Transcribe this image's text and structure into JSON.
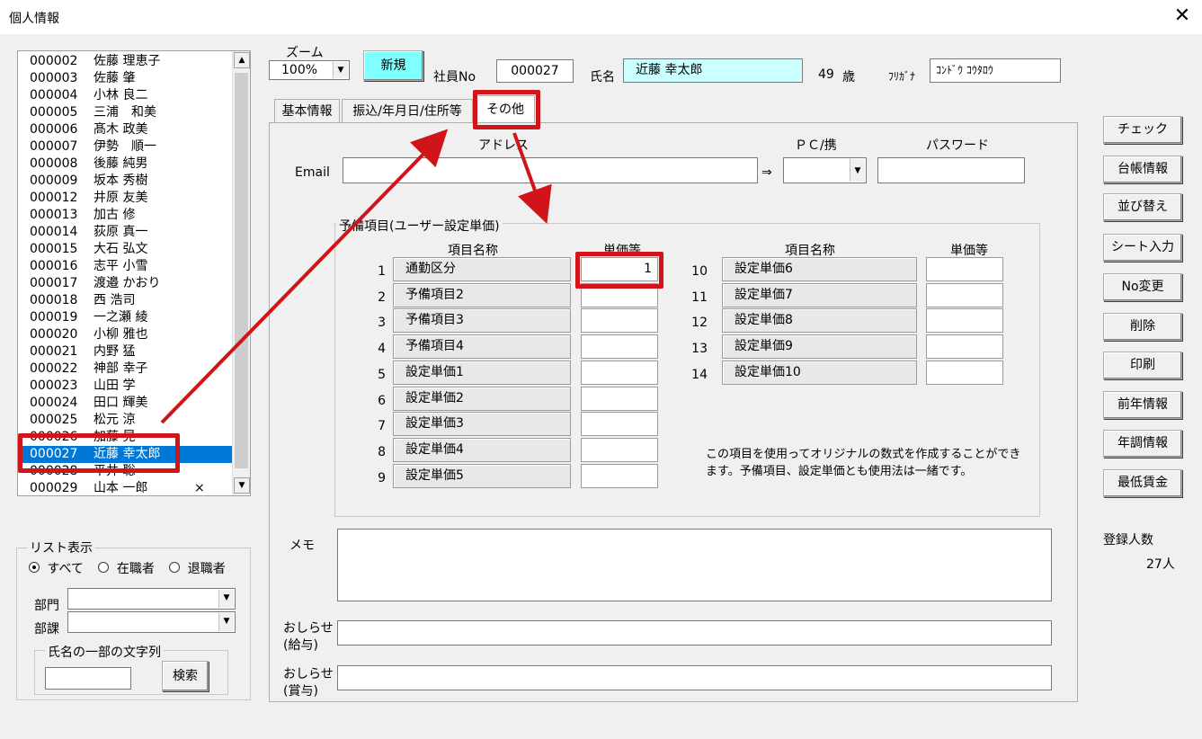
{
  "window": {
    "title": "個人情報",
    "close_glyph": "✕"
  },
  "employees": [
    {
      "id": "000002",
      "name": "佐藤 理恵子"
    },
    {
      "id": "000003",
      "name": "佐藤 肇"
    },
    {
      "id": "000004",
      "name": "小林 良二"
    },
    {
      "id": "000005",
      "name": "三浦　和美"
    },
    {
      "id": "000006",
      "name": "髙木 政美"
    },
    {
      "id": "000007",
      "name": "伊勢　順一"
    },
    {
      "id": "000008",
      "name": "後藤 純男"
    },
    {
      "id": "000009",
      "name": "坂本 秀樹"
    },
    {
      "id": "000012",
      "name": "井原 友美"
    },
    {
      "id": "000013",
      "name": "加古 修"
    },
    {
      "id": "000014",
      "name": "荻原 真一"
    },
    {
      "id": "000015",
      "name": "大石 弘文"
    },
    {
      "id": "000016",
      "name": "志平 小雪"
    },
    {
      "id": "000017",
      "name": "渡邉 かおり"
    },
    {
      "id": "000018",
      "name": "西 浩司"
    },
    {
      "id": "000019",
      "name": "一之瀬 綾"
    },
    {
      "id": "000020",
      "name": "小柳 雅也"
    },
    {
      "id": "000021",
      "name": "内野 猛"
    },
    {
      "id": "000022",
      "name": "神部 幸子"
    },
    {
      "id": "000023",
      "name": "山田 学"
    },
    {
      "id": "000024",
      "name": "田口 輝美"
    },
    {
      "id": "000025",
      "name": "松元 涼"
    },
    {
      "id": "000026",
      "name": "加藤 晃"
    },
    {
      "id": "000027",
      "name": "近藤 幸太郎"
    },
    {
      "id": "000028",
      "name": "平井 聡"
    },
    {
      "id": "000029",
      "name": "山本 一郎",
      "mark": "×"
    }
  ],
  "list_display": {
    "label": "リスト表示",
    "options": [
      "すべて",
      "在職者",
      "退職者"
    ],
    "dept_label": "部門",
    "section_label": "部課",
    "name_search_label": "氏名の一部の文字列",
    "search_button": "検索"
  },
  "header": {
    "zoom_label": "ズーム",
    "zoom_value": "100%",
    "new_button": "新規",
    "emp_no_label": "社員No",
    "emp_no": "000027",
    "name_label": "氏名",
    "name": "近藤 幸太郎",
    "age": "49",
    "age_unit": "歳",
    "furigana_label": "ﾌﾘｶﾞﾅ",
    "furigana": "ｺﾝﾄﾞｳ ｺｳﾀﾛｳ"
  },
  "tabs": [
    "基本情報",
    "振込/年月日/住所等",
    "その他"
  ],
  "other": {
    "address_label": "アドレス",
    "pc_label": "ＰＣ/携",
    "password_label": "パスワード",
    "email_label": "Email",
    "arrow": "⇒",
    "reserve_group_label": "予備項目(ユーザー設定単価)",
    "col_name": "項目名称",
    "col_price": "単価等",
    "left_items": [
      {
        "no": "1",
        "name": "通勤区分",
        "value": "1"
      },
      {
        "no": "2",
        "name": "予備項目2",
        "value": ""
      },
      {
        "no": "3",
        "name": "予備項目3",
        "value": ""
      },
      {
        "no": "4",
        "name": "予備項目4",
        "value": ""
      },
      {
        "no": "5",
        "name": "設定単価1",
        "value": ""
      },
      {
        "no": "6",
        "name": "設定単価2",
        "value": ""
      },
      {
        "no": "7",
        "name": "設定単価3",
        "value": ""
      },
      {
        "no": "8",
        "name": "設定単価4",
        "value": ""
      },
      {
        "no": "9",
        "name": "設定単価5",
        "value": ""
      }
    ],
    "right_items": [
      {
        "no": "10",
        "name": "設定単価6",
        "value": ""
      },
      {
        "no": "11",
        "name": "設定単価7",
        "value": ""
      },
      {
        "no": "12",
        "name": "設定単価8",
        "value": ""
      },
      {
        "no": "13",
        "name": "設定単価9",
        "value": ""
      },
      {
        "no": "14",
        "name": "設定単価10",
        "value": ""
      }
    ],
    "note_line1": "この項目を使用ってオリジナルの数式を作成することができ",
    "note_line2": "ます。予備項目、設定単価とも使用法は一緒です。",
    "memo_label": "メモ",
    "notice_label": "おしらせ",
    "salary_label": "(給与)",
    "bonus_label": "(賞与)"
  },
  "side_buttons": [
    "チェック",
    "台帳情報",
    "並び替え",
    "シート入力",
    "No変更",
    "削除",
    "印刷",
    "前年情報",
    "年調情報",
    "最低賃金"
  ],
  "registered": {
    "label": "登録人数",
    "count": "27人"
  },
  "colors": {
    "selection": "#0078d7",
    "new_button": "#80ffff",
    "name_field": "#ccffff",
    "annotation_red": "#d0141a"
  }
}
